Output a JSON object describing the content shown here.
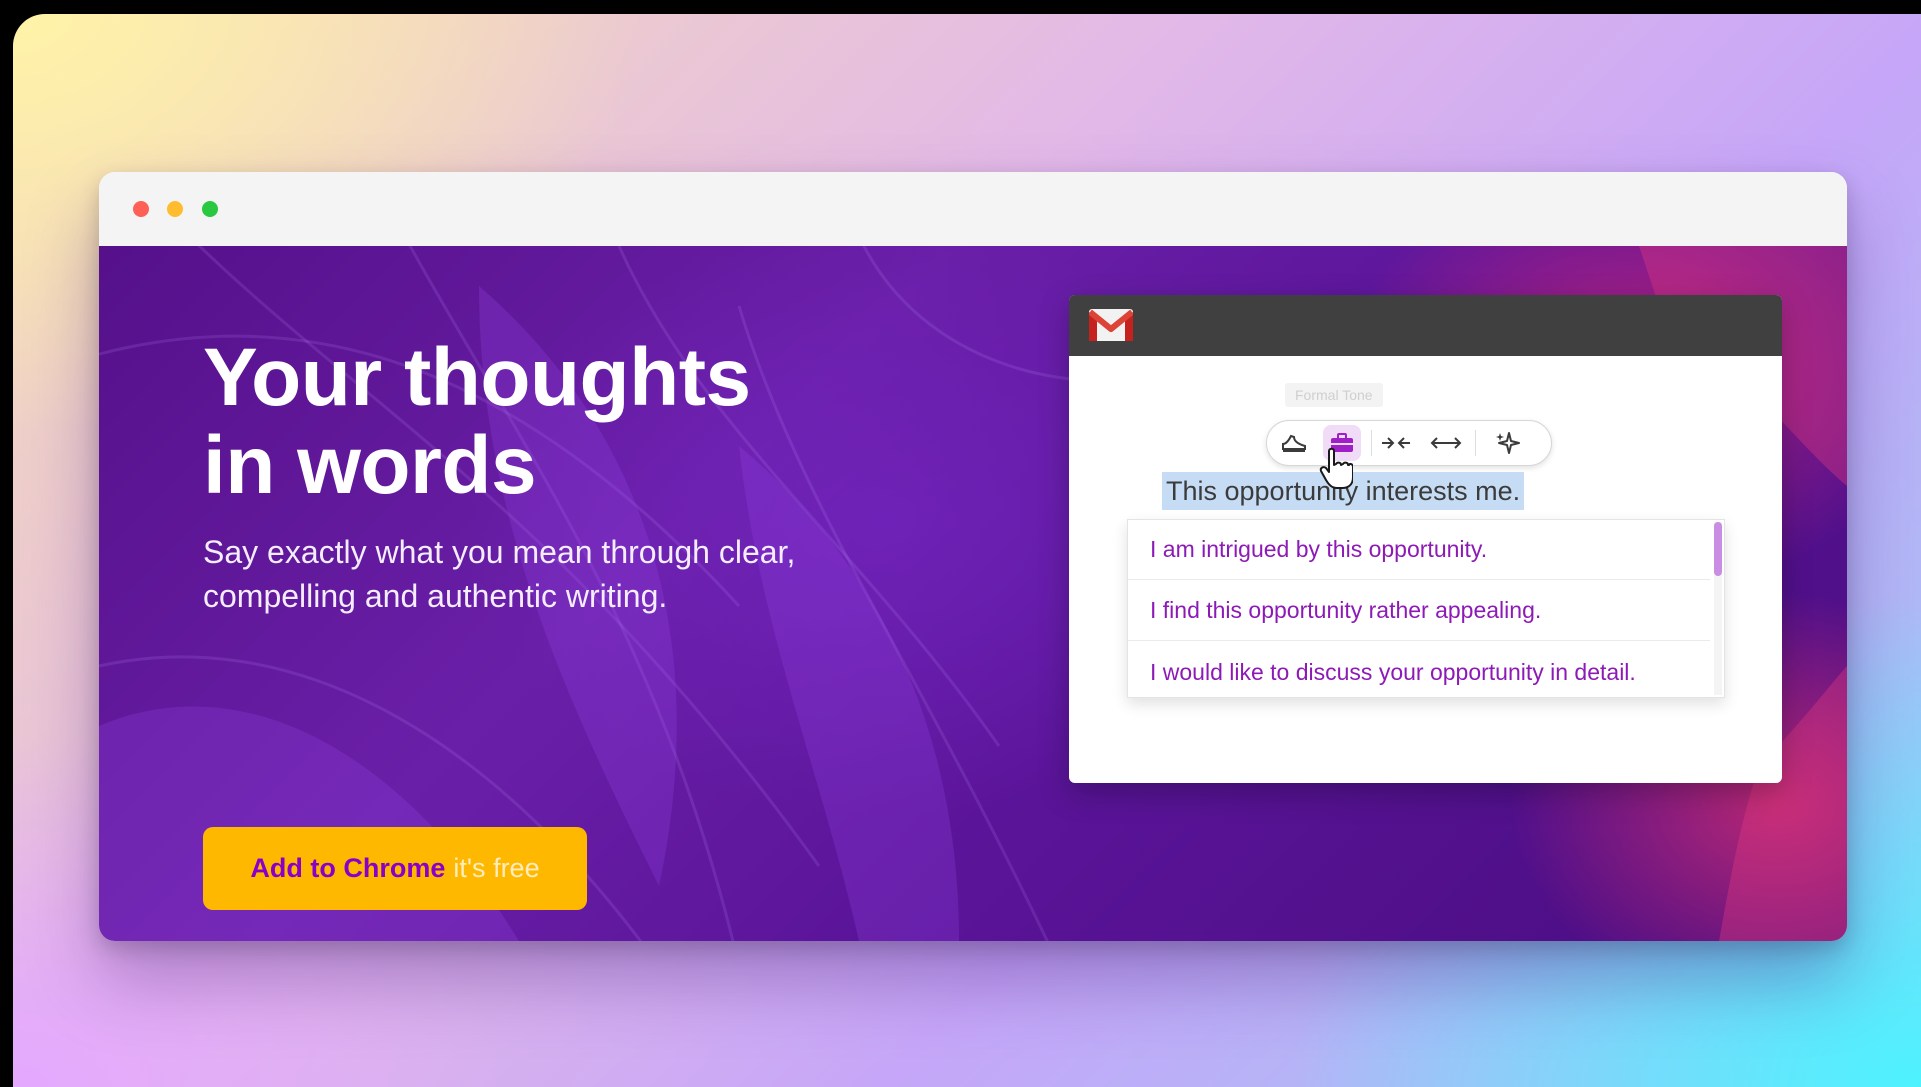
{
  "browser": {
    "window_controls": [
      "close",
      "minimize",
      "maximize"
    ]
  },
  "hero": {
    "headline_line1": "Your thoughts",
    "headline_line2": "in words",
    "subline_line1": "Say exactly what you mean through clear,",
    "subline_line2": "compelling and authentic writing.",
    "cta_label": "Add to Chrome",
    "cta_sublabel": "it's free"
  },
  "demo": {
    "app_logo": "gmail-icon",
    "tooltip": "Formal Tone",
    "toolbar_tools": [
      {
        "icon": "casual-shoe-icon",
        "active": false
      },
      {
        "icon": "briefcase-icon",
        "active": true
      },
      {
        "icon": "shorten-arrows-icon",
        "active": false
      },
      {
        "icon": "expand-arrows-icon",
        "active": false
      },
      {
        "icon": "sparkles-icon",
        "active": false
      }
    ],
    "selected_text": "This opportunity interests me.",
    "suggestions": [
      "I am intrigued by this opportunity.",
      "I find this opportunity rather appealing.",
      "I would like to discuss your opportunity in detail."
    ]
  },
  "colors": {
    "cta_background": "#ffb800",
    "cta_text": "#8b00c8",
    "suggestion_text": "#8d1ab6",
    "selection_highlight": "#c6dcf5",
    "active_tool": "#f1dcf7"
  }
}
